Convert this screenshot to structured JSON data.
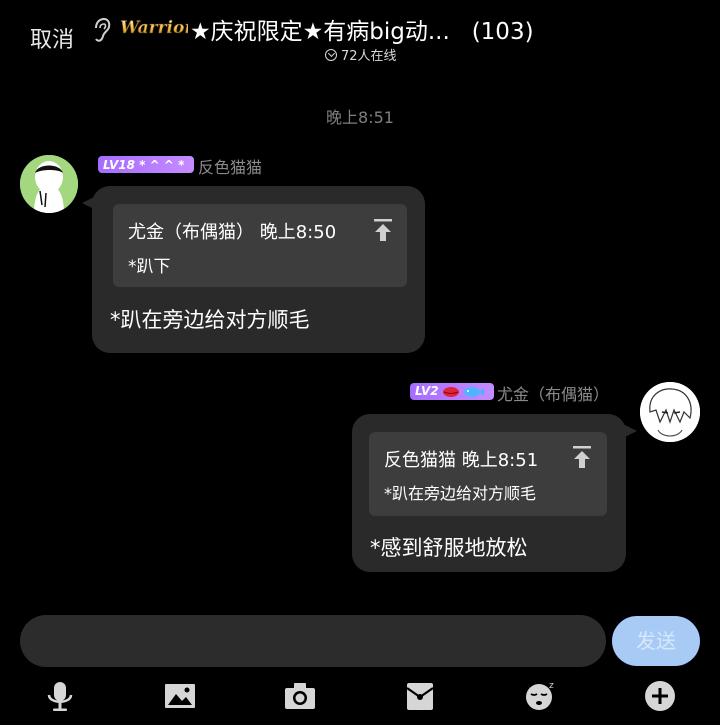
{
  "header": {
    "cancel_label": "取消",
    "badge_text": "Warrior",
    "title": "★庆祝限定★有病big动...",
    "member_count": "(103)",
    "online_text": "72人在线"
  },
  "chat": {
    "timestamp": "晚上8:51",
    "messages": [
      {
        "side": "left",
        "level": "LV18",
        "level_decor": "* ^  ^ *",
        "username": "反色猫猫",
        "quote_header": "尤金（布偶猫） 晚上8:50",
        "quote_body": "*趴下",
        "text": "*趴在旁边给对方顺毛"
      },
      {
        "side": "right",
        "level": "LV2",
        "username": "尤金（布偶猫）",
        "quote_header": "反色猫猫 晚上8:51",
        "quote_body": "*趴在旁边给对方顺毛",
        "text": "*感到舒服地放松"
      }
    ]
  },
  "input_bar": {
    "send_label": "发送",
    "placeholder": ""
  },
  "toolbar": {
    "icons": [
      "microphone-icon",
      "image-icon",
      "camera-icon",
      "red-packet-icon",
      "sleep-emoji-icon",
      "plus-icon"
    ]
  },
  "colors": {
    "background": "#000000",
    "bubble": "#2a2a2a",
    "quote": "#3d3d3d",
    "level_badge": "#a66cff",
    "send_button": "#a7cbf5"
  }
}
